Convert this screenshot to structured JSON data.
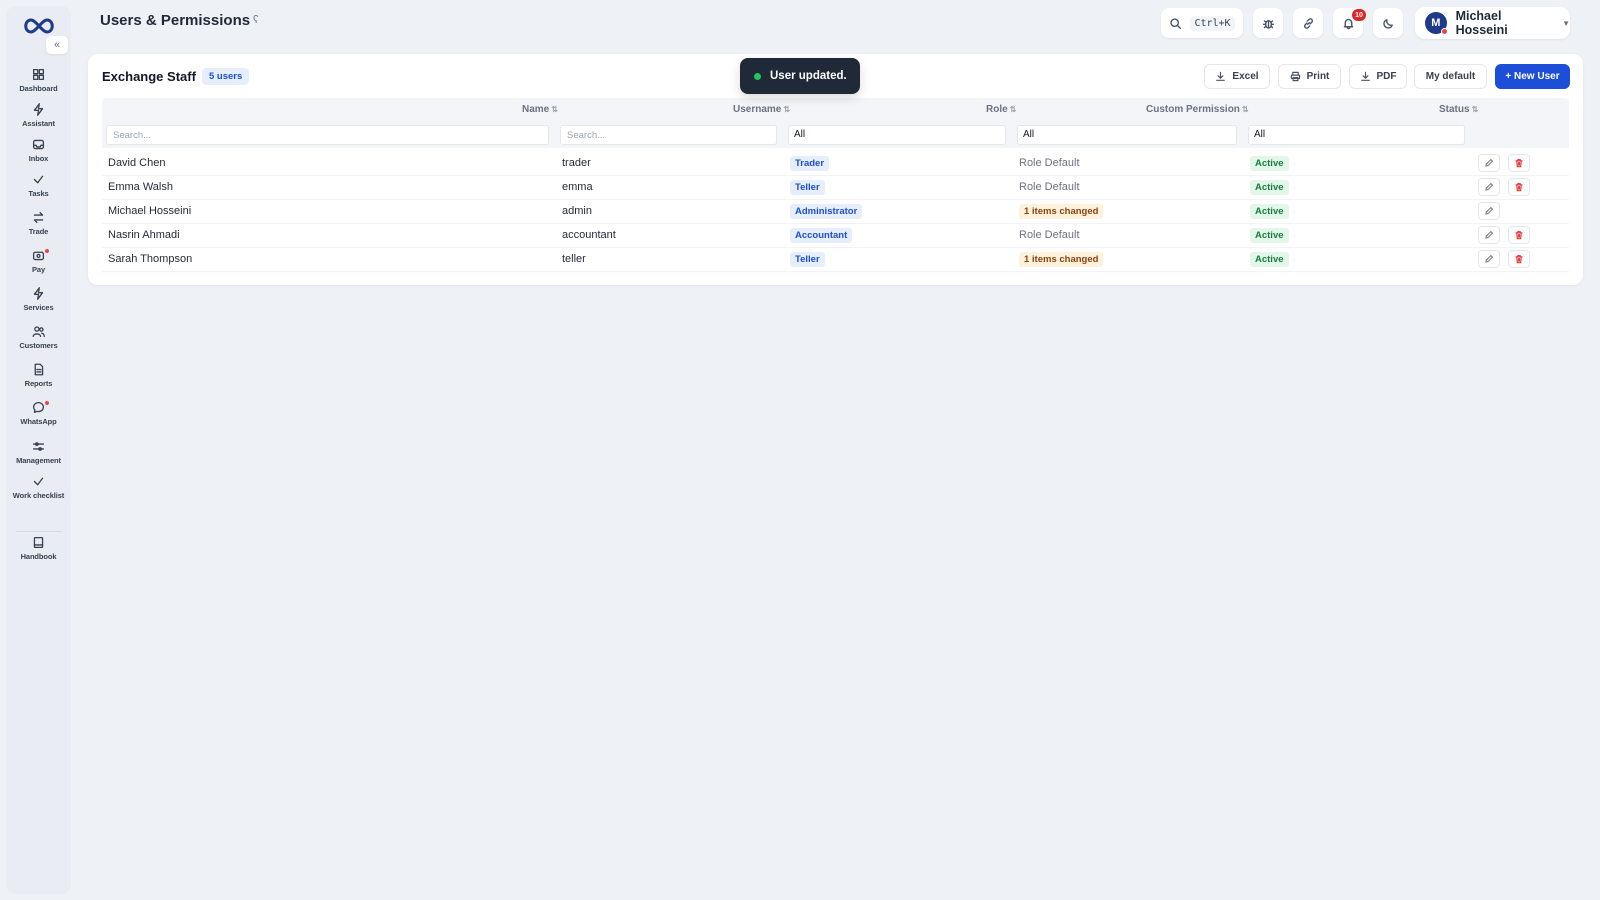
{
  "header": {
    "title": "Users & Permissions",
    "search_shortcut": "Ctrl+K",
    "notification_count": "10",
    "user": {
      "initial": "M",
      "name": "Michael Hosseini"
    }
  },
  "sidebar": {
    "items": [
      {
        "label": "Dashboard",
        "icon": "dashboard-icon"
      },
      {
        "label": "Assistant",
        "icon": "bolt-icon"
      },
      {
        "label": "Inbox",
        "icon": "inbox-icon"
      },
      {
        "label": "Tasks",
        "icon": "check-icon"
      },
      {
        "label": "Trade",
        "icon": "swap-icon"
      },
      {
        "label": "Pay",
        "icon": "wallet-icon"
      },
      {
        "label": "Services",
        "icon": "bolt-icon"
      },
      {
        "label": "Customers",
        "icon": "users-icon"
      },
      {
        "label": "Reports",
        "icon": "document-icon"
      },
      {
        "label": "WhatsApp",
        "icon": "chat-icon"
      },
      {
        "label": "Management",
        "icon": "sliders-icon"
      },
      {
        "label": "Work checklist",
        "icon": "check-icon"
      },
      {
        "label": "Handbook",
        "icon": "book-icon"
      }
    ]
  },
  "card": {
    "title": "Exchange Staff",
    "count_badge": "5 users",
    "buttons": {
      "excel": "Excel",
      "print": "Print",
      "pdf": "PDF",
      "my_default": "My default",
      "new_user": "+ New User"
    }
  },
  "table": {
    "columns": {
      "name": "Name",
      "username": "Username",
      "role": "Role",
      "custom_permission": "Custom Permission",
      "status": "Status"
    },
    "filters": {
      "name_placeholder": "Search...",
      "username_placeholder": "Search...",
      "role": "All",
      "custom_permission": "All",
      "status": "All"
    },
    "rows": [
      {
        "name": "David Chen",
        "username": "trader",
        "role": "Trader",
        "permission": "Role Default",
        "status": "Active"
      },
      {
        "name": "Emma Walsh",
        "username": "emma",
        "role": "Teller",
        "permission": "Role Default",
        "status": "Active"
      },
      {
        "name": "Michael Hosseini",
        "username": "admin",
        "role": "Administrator",
        "permission": "1 items changed",
        "status": "Active"
      },
      {
        "name": "Nasrin Ahmadi",
        "username": "accountant",
        "role": "Accountant",
        "permission": "Role Default",
        "status": "Active"
      },
      {
        "name": "Sarah Thompson",
        "username": "teller",
        "role": "Teller",
        "permission": "1 items changed",
        "status": "Active"
      }
    ]
  },
  "toast": {
    "message": "User updated."
  },
  "colors": {
    "primary": "#1d4ed8",
    "success": "#15803d",
    "danger": "#dc2626",
    "warning": "#92400e"
  }
}
